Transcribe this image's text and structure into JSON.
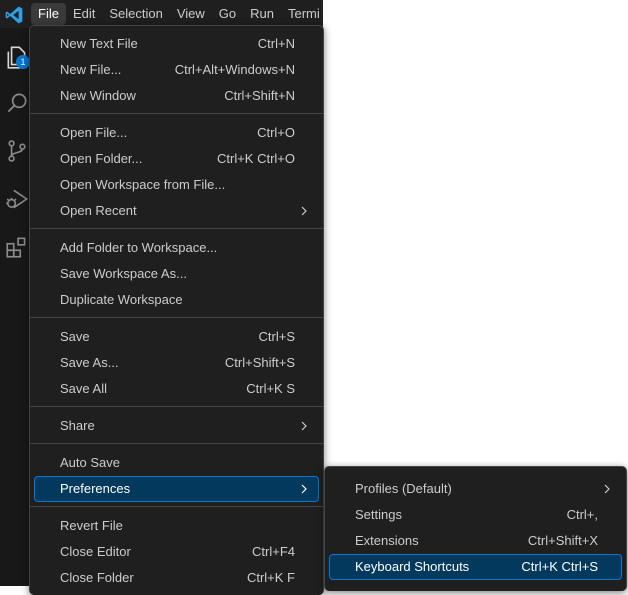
{
  "colors": {
    "menu_bg": "#1f1f1f",
    "menu_border": "#454545",
    "highlight_bg": "#04395e",
    "accent": "#0078d4",
    "text": "#cccccc",
    "badge": "#0078d4"
  },
  "app": {
    "logo_icon": "vscode-logo-icon"
  },
  "menubar": {
    "items": [
      "File",
      "Edit",
      "Selection",
      "View",
      "Go",
      "Run",
      "Termi"
    ]
  },
  "activity": {
    "icons": [
      "explorer-icon",
      "search-icon",
      "source-control-icon",
      "run-debug-icon",
      "extensions-icon"
    ],
    "explorer_badge": "1"
  },
  "file_menu": {
    "items": [
      {
        "label": "New Text File",
        "kb": "Ctrl+N"
      },
      {
        "label": "New File...",
        "kb": "Ctrl+Alt+Windows+N"
      },
      {
        "label": "New Window",
        "kb": "Ctrl+Shift+N"
      },
      {
        "label": "Open File...",
        "kb": "Ctrl+O"
      },
      {
        "label": "Open Folder...",
        "kb": "Ctrl+K Ctrl+O"
      },
      {
        "label": "Open Workspace from File...",
        "kb": ""
      },
      {
        "label": "Open Recent",
        "kb": "",
        "submenu": true
      },
      {
        "label": "Add Folder to Workspace...",
        "kb": ""
      },
      {
        "label": "Save Workspace As...",
        "kb": ""
      },
      {
        "label": "Duplicate Workspace",
        "kb": ""
      },
      {
        "label": "Save",
        "kb": "Ctrl+S"
      },
      {
        "label": "Save As...",
        "kb": "Ctrl+Shift+S"
      },
      {
        "label": "Save All",
        "kb": "Ctrl+K S"
      },
      {
        "label": "Share",
        "kb": "",
        "submenu": true
      },
      {
        "label": "Auto Save",
        "kb": ""
      },
      {
        "label": "Preferences",
        "kb": "",
        "submenu": true,
        "highlighted": true
      },
      {
        "label": "Revert File",
        "kb": ""
      },
      {
        "label": "Close Editor",
        "kb": "Ctrl+F4"
      },
      {
        "label": "Close Folder",
        "kb": "Ctrl+K F"
      }
    ]
  },
  "preferences_menu": {
    "items": [
      {
        "label": "Profiles (Default)",
        "kb": "",
        "submenu": true
      },
      {
        "label": "Settings",
        "kb": "Ctrl+,"
      },
      {
        "label": "Extensions",
        "kb": "Ctrl+Shift+X"
      },
      {
        "label": "Keyboard Shortcuts",
        "kb": "Ctrl+K Ctrl+S",
        "highlighted": true
      }
    ]
  }
}
